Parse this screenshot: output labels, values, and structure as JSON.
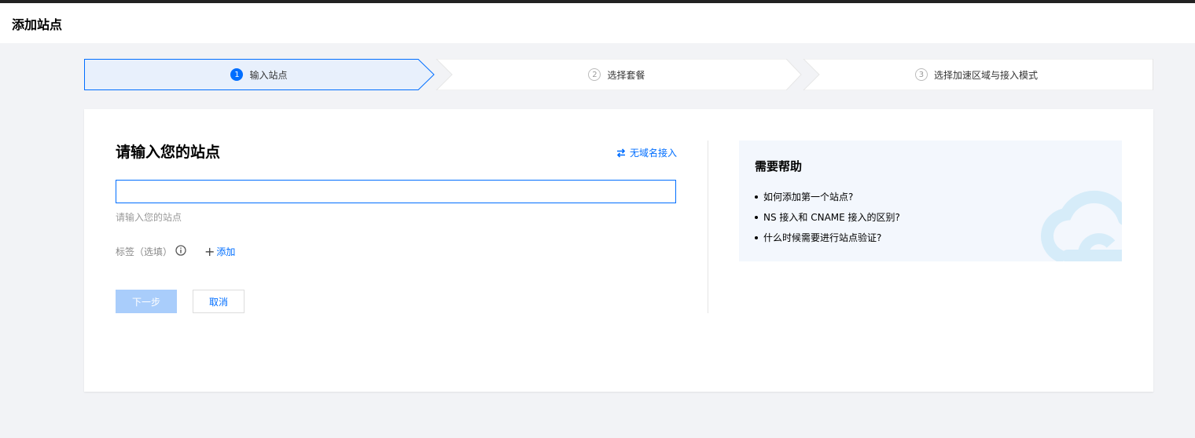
{
  "page": {
    "title": "添加站点"
  },
  "stepper": {
    "steps": [
      {
        "num": "1",
        "label": "输入站点",
        "active": true
      },
      {
        "num": "2",
        "label": "选择套餐",
        "active": false
      },
      {
        "num": "3",
        "label": "选择加速区域与接入模式",
        "active": false
      }
    ]
  },
  "form": {
    "title": "请输入您的站点",
    "no_domain_link": "无域名接入",
    "site_input_value": "",
    "hint": "请输入您的站点",
    "tag_label": "标签（选填）",
    "add_tag": "添加",
    "next_button": "下一步",
    "cancel_button": "取消"
  },
  "help": {
    "title": "需要帮助",
    "items": [
      "如何添加第一个站点?",
      "NS 接入和 CNAME 接入的区别?",
      "什么时候需要进行站点验证?"
    ]
  },
  "colors": {
    "accent": "#006eff",
    "active_step_bg": "#e8f0fc",
    "next_disabled": "#a9cdfb",
    "help_bg": "#f3f7fd"
  }
}
